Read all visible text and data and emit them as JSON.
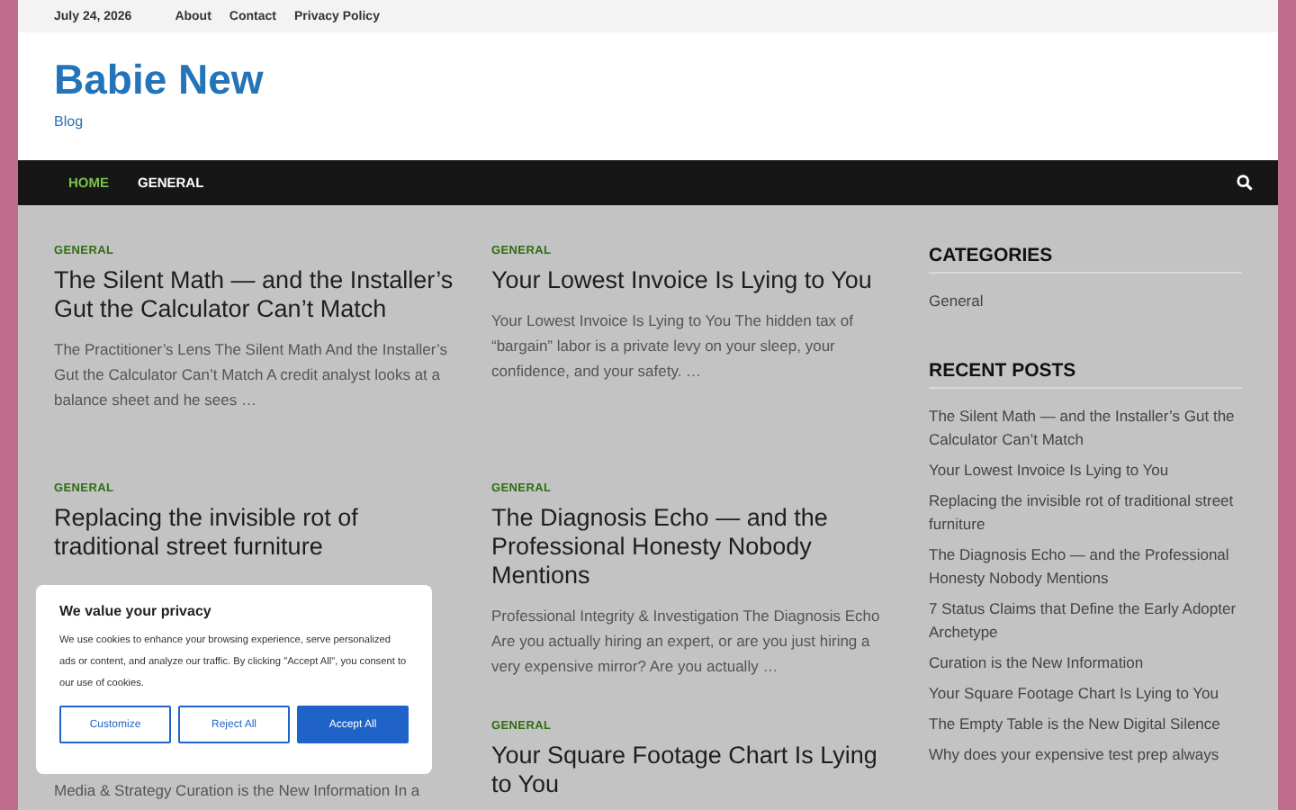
{
  "top_bar": {
    "date": "July 24, 2026",
    "links": [
      "About",
      "Contact",
      "Privacy Policy"
    ]
  },
  "header": {
    "site_title": "Babie New",
    "tagline": "Blog"
  },
  "nav": {
    "items": [
      {
        "label": "HOME",
        "selected": true
      },
      {
        "label": "GENERAL",
        "selected": false
      }
    ]
  },
  "posts": [
    {
      "category": "GENERAL",
      "title": "The Silent Math — and the Installer’s Gut the Calculator Can’t Match",
      "excerpt": "The Practitioner’s Lens The Silent Math And the Installer’s Gut the Calculator Can’t Match A credit analyst looks at a balance sheet and he sees …"
    },
    {
      "category": "GENERAL",
      "title": "Your Lowest Invoice Is Lying to You",
      "excerpt": "Your Lowest Invoice Is Lying to You The hidden tax of “bargain” labor is a private levy on your sleep, your confidence, and your safety. …"
    },
    {
      "category": "GENERAL",
      "title": "Replacing the invisible rot of traditional street furniture"
    },
    {
      "category": "GENERAL",
      "title": "The Diagnosis Echo — and the Professional Honesty Nobody Mentions",
      "excerpt": "Professional Integrity & Investigation The Diagnosis Echo Are you actually hiring an expert, or are you just hiring a very expensive mirror? Are you actually …"
    },
    {
      "category": "GENERAL",
      "title": "Your Square Footage Chart Is Lying to You"
    },
    {
      "kind": "covered",
      "excerpt": "Media & Strategy Curation is the New Information In a"
    }
  ],
  "sidebar": {
    "categories": {
      "heading": "CATEGORIES",
      "items": [
        "General"
      ]
    },
    "recent_posts": {
      "heading": "RECENT POSTS",
      "items": [
        "The Silent Math — and the Installer’s Gut the Calculator Can’t Match",
        "Your Lowest Invoice Is Lying to You",
        "Replacing the invisible rot of traditional street furniture",
        "The Diagnosis Echo — and the Professional Honesty Nobody Mentions",
        "7 Status Claims that Define the Early Adopter Archetype",
        "Curation is the New Information",
        "Your Square Footage Chart Is Lying to You",
        "The Empty Table is the New Digital Silence",
        "Why does your expensive test prep always"
      ]
    }
  },
  "cookie_banner": {
    "title": "We value your privacy",
    "text": "We use cookies to enhance your browsing experience, serve personalized ads or content, and analyze our traffic. By clicking \"Accept All\", you consent to our use of cookies.",
    "buttons": [
      {
        "label": "Customize",
        "kind": "outline"
      },
      {
        "label": "Reject All",
        "kind": "outline"
      },
      {
        "label": "Accept All",
        "kind": "primary"
      }
    ]
  }
}
